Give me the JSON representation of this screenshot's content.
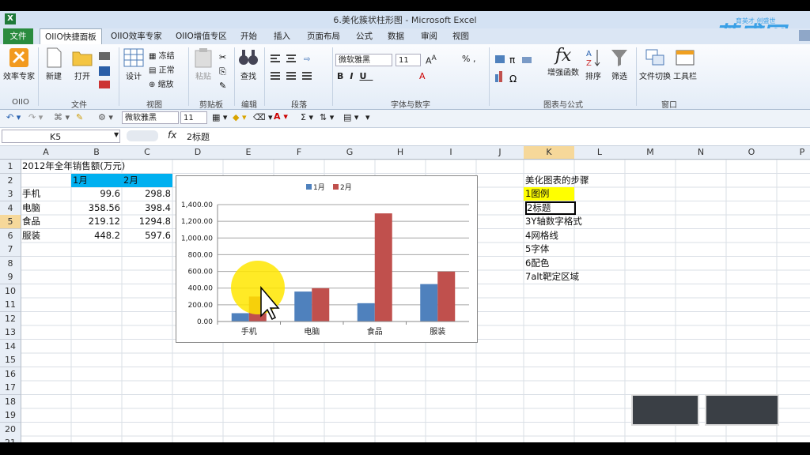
{
  "window": {
    "title": "6.美化簇状柱形图 - Microsoft Excel",
    "app_icon": "X"
  },
  "watermark": {
    "logo_text": "英盛网",
    "tagline": "育英才 创盛世"
  },
  "tabs": [
    "文件",
    "OIIO快捷面板",
    "OIIO效率专家",
    "OIIO增值专区",
    "开始",
    "插入",
    "页面布局",
    "公式",
    "数据",
    "审阅",
    "视图"
  ],
  "ribbon": {
    "buttons": {
      "efficiency": "效率专家",
      "new": "新建",
      "open": "打开",
      "design": "设计",
      "freeze": "冻结",
      "normal": "正常",
      "zoom": "缩放",
      "paste": "粘贴",
      "find": "查找",
      "font_name": "微软雅黑",
      "font_size": "11",
      "enhanced_func": "增强函数",
      "sort": "排序",
      "filter": "筛选",
      "window_switch": "文件切换",
      "toolbar": "工具栏"
    },
    "groups": [
      "OIIO",
      "文件",
      "视图",
      "剪贴板",
      "编辑",
      "段落",
      "字体与数字",
      "图表与公式",
      "窗口"
    ]
  },
  "qat": {
    "font_name": "微软雅黑",
    "font_size": "11"
  },
  "formula_bar": {
    "name_box": "K5",
    "fx": "fx",
    "content": "2标题"
  },
  "columns": [
    "A",
    "B",
    "C",
    "D",
    "E",
    "F",
    "G",
    "H",
    "I",
    "J",
    "K",
    "L",
    "M",
    "N",
    "O",
    "P"
  ],
  "rows": [
    "1",
    "2",
    "3",
    "4",
    "5",
    "6",
    "7",
    "8",
    "9",
    "10",
    "11",
    "12",
    "13",
    "14",
    "15",
    "16",
    "17",
    "18",
    "19",
    "20",
    "21"
  ],
  "sheet": {
    "a1": "2012年全年销售额(万元)",
    "header": {
      "b": "1月",
      "c": "2月"
    },
    "data_rows": [
      {
        "label": "手机",
        "jan": "99.6",
        "feb": "298.8"
      },
      {
        "label": "电脑",
        "jan": "358.56",
        "feb": "398.4"
      },
      {
        "label": "食品",
        "jan": "219.12",
        "feb": "1294.8"
      },
      {
        "label": "服装",
        "jan": "448.2",
        "feb": "597.6"
      }
    ],
    "steps": [
      "美化图表的步骤",
      "1图例",
      "2标题",
      "3Y轴数字格式",
      "4网格线",
      "5字体",
      "6配色",
      "7alt靶定区域"
    ]
  },
  "colors": {
    "series1": "#4f81bd",
    "series2": "#c0504d",
    "header_fill": "#00b0f0",
    "highlight": "#ffff00"
  },
  "chart_data": {
    "type": "bar",
    "categories": [
      "手机",
      "电脑",
      "食品",
      "服装"
    ],
    "series": [
      {
        "name": "1月",
        "values": [
          99.6,
          358.56,
          219.12,
          448.2
        ]
      },
      {
        "name": "2月",
        "values": [
          298.8,
          398.4,
          1294.8,
          597.6
        ]
      }
    ],
    "y_ticks": [
      "0.00",
      "200.00",
      "400.00",
      "600.00",
      "800.00",
      "1,000.00",
      "1,200.00",
      "1,400.00"
    ],
    "ylim": [
      0,
      1400
    ],
    "grid": true,
    "legend_position": "top"
  }
}
